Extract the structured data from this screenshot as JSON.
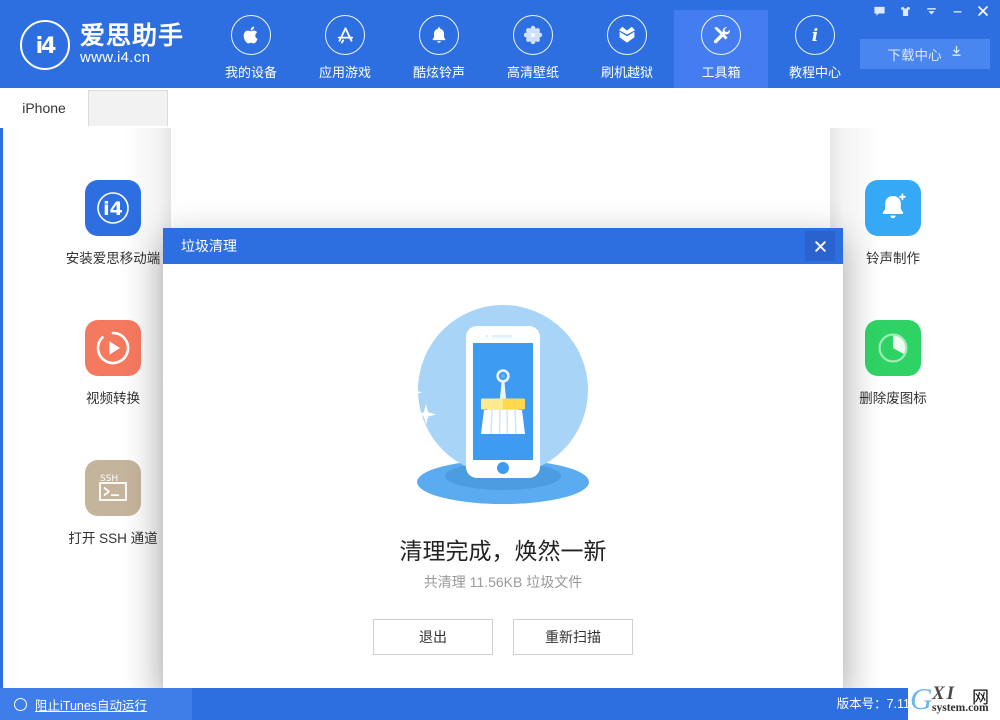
{
  "app": {
    "logo_mark": "i4",
    "logo_name": "爱思助手",
    "logo_url": "www.i4.cn"
  },
  "header": {
    "nav": [
      {
        "label": "我的设备",
        "icon": "apple-icon"
      },
      {
        "label": "应用游戏",
        "icon": "appstore-icon"
      },
      {
        "label": "酷炫铃声",
        "icon": "bell-icon"
      },
      {
        "label": "高清壁纸",
        "icon": "flower-icon"
      },
      {
        "label": "刷机越狱",
        "icon": "open-box-icon"
      },
      {
        "label": "工具箱",
        "icon": "tools-icon"
      },
      {
        "label": "教程中心",
        "icon": "info-icon"
      }
    ],
    "active_nav_index": 5,
    "download_center": "下载中心",
    "window_buttons": [
      {
        "name": "message-icon"
      },
      {
        "name": "skin-shirt-icon"
      },
      {
        "name": "collapse-icon"
      },
      {
        "name": "minimize-icon"
      },
      {
        "name": "close-icon"
      }
    ]
  },
  "tabs": {
    "items": [
      {
        "label": "iPhone"
      }
    ],
    "active_index": 0
  },
  "tools": {
    "left": [
      {
        "label": "安装爱思移动端",
        "icon": "i4-app-icon",
        "color": "#2d6fe0"
      },
      {
        "label": "视频转换",
        "icon": "play-circle-icon",
        "color": "#f5795f"
      },
      {
        "label": "打开 SSH 通道",
        "icon": "ssh-terminal-icon",
        "color": "#c3b49b"
      }
    ],
    "right": [
      {
        "label": "铃声制作",
        "icon": "bell-plus-icon",
        "color": "#35a9f5"
      },
      {
        "label": "删除废图标",
        "icon": "pie-clock-icon",
        "color": "#2fd365"
      }
    ]
  },
  "dialog": {
    "title": "垃圾清理",
    "close_icon": "close-icon",
    "illustration": "phone-broom-clean-illustration",
    "result_title": "清理完成，焕然一新",
    "result_sub": "共清理 11.56KB 垃圾文件",
    "buttons": [
      {
        "label": "退出",
        "name": "exit-button"
      },
      {
        "label": "重新扫描",
        "name": "rescan-button"
      }
    ]
  },
  "statusbar": {
    "itunes_label": "阻止iTunes自动运行",
    "version_label": "版本号：7.11"
  },
  "watermark": {
    "g": "G",
    "xi": "XI",
    "net": "网",
    "system": "system.com"
  },
  "colors": {
    "brand_blue": "#2d6fe0",
    "nav_active": "#437df0",
    "dialog_blue": "#2d6fe0",
    "illustration_circle": "#a8d4f8",
    "illustration_screen": "#3d9bf2",
    "broom_band": "#ffd84d"
  }
}
